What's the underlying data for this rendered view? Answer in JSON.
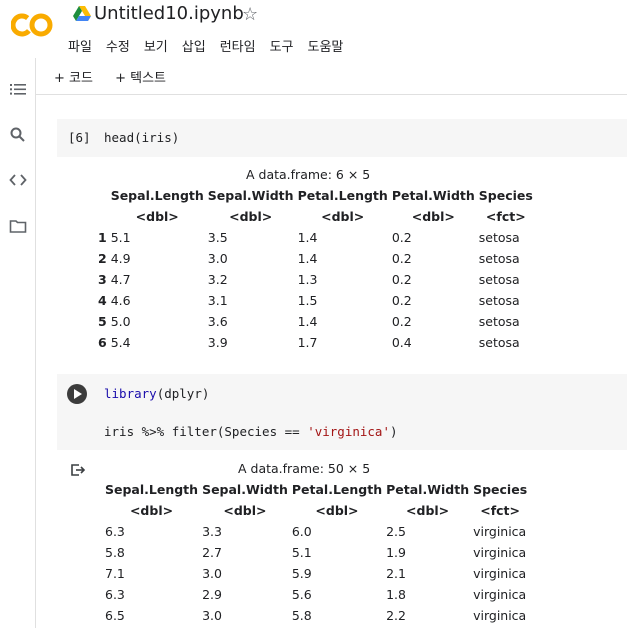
{
  "header": {
    "title": "Untitled10.ipynb",
    "logo_text": "CO",
    "menu": [
      "파일",
      "수정",
      "보기",
      "삽입",
      "런타임",
      "도구",
      "도움말"
    ]
  },
  "toolbar": {
    "add_code": "+ 코드",
    "add_text": "+ 텍스트"
  },
  "sidebar": {
    "icons": [
      "menu-icon",
      "search-icon",
      "code-icon",
      "folder-icon"
    ]
  },
  "cell1": {
    "prompt": "[6]",
    "code": "head(iris)",
    "caption": "A data.frame: 6 × 5",
    "columns": [
      "",
      "Sepal.Length",
      "Sepal.Width",
      "Petal.Length",
      "Petal.Width",
      "Species"
    ],
    "types": [
      "",
      "<dbl>",
      "<dbl>",
      "<dbl>",
      "<dbl>",
      "<fct>"
    ],
    "rows": [
      [
        "1",
        "5.1",
        "3.5",
        "1.4",
        "0.2",
        "setosa"
      ],
      [
        "2",
        "4.9",
        "3.0",
        "1.4",
        "0.2",
        "setosa"
      ],
      [
        "3",
        "4.7",
        "3.2",
        "1.3",
        "0.2",
        "setosa"
      ],
      [
        "4",
        "4.6",
        "3.1",
        "1.5",
        "0.2",
        "setosa"
      ],
      [
        "5",
        "5.0",
        "3.6",
        "1.4",
        "0.2",
        "setosa"
      ],
      [
        "6",
        "5.4",
        "3.9",
        "1.7",
        "0.4",
        "setosa"
      ]
    ]
  },
  "cell2": {
    "line1_kw": "library",
    "line1_rest": "(dplyr)",
    "line2_pre": "iris %>% filter(Species == ",
    "line2_str": "'virginica'",
    "line2_post": ")",
    "caption": "A data.frame: 50 × 5",
    "columns": [
      "Sepal.Length",
      "Sepal.Width",
      "Petal.Length",
      "Petal.Width",
      "Species"
    ],
    "types": [
      "<dbl>",
      "<dbl>",
      "<dbl>",
      "<dbl>",
      "<fct>"
    ],
    "rows": [
      [
        "6.3",
        "3.3",
        "6.0",
        "2.5",
        "virginica"
      ],
      [
        "5.8",
        "2.7",
        "5.1",
        "1.9",
        "virginica"
      ],
      [
        "7.1",
        "3.0",
        "5.9",
        "2.1",
        "virginica"
      ],
      [
        "6.3",
        "2.9",
        "5.6",
        "1.8",
        "virginica"
      ],
      [
        "6.5",
        "3.0",
        "5.8",
        "2.2",
        "virginica"
      ]
    ]
  },
  "colors": {
    "logo_orange": "#F9AB00",
    "keyword": "#1a0dab",
    "string": "#a31515",
    "cell_bg": "#f6f6f6"
  }
}
